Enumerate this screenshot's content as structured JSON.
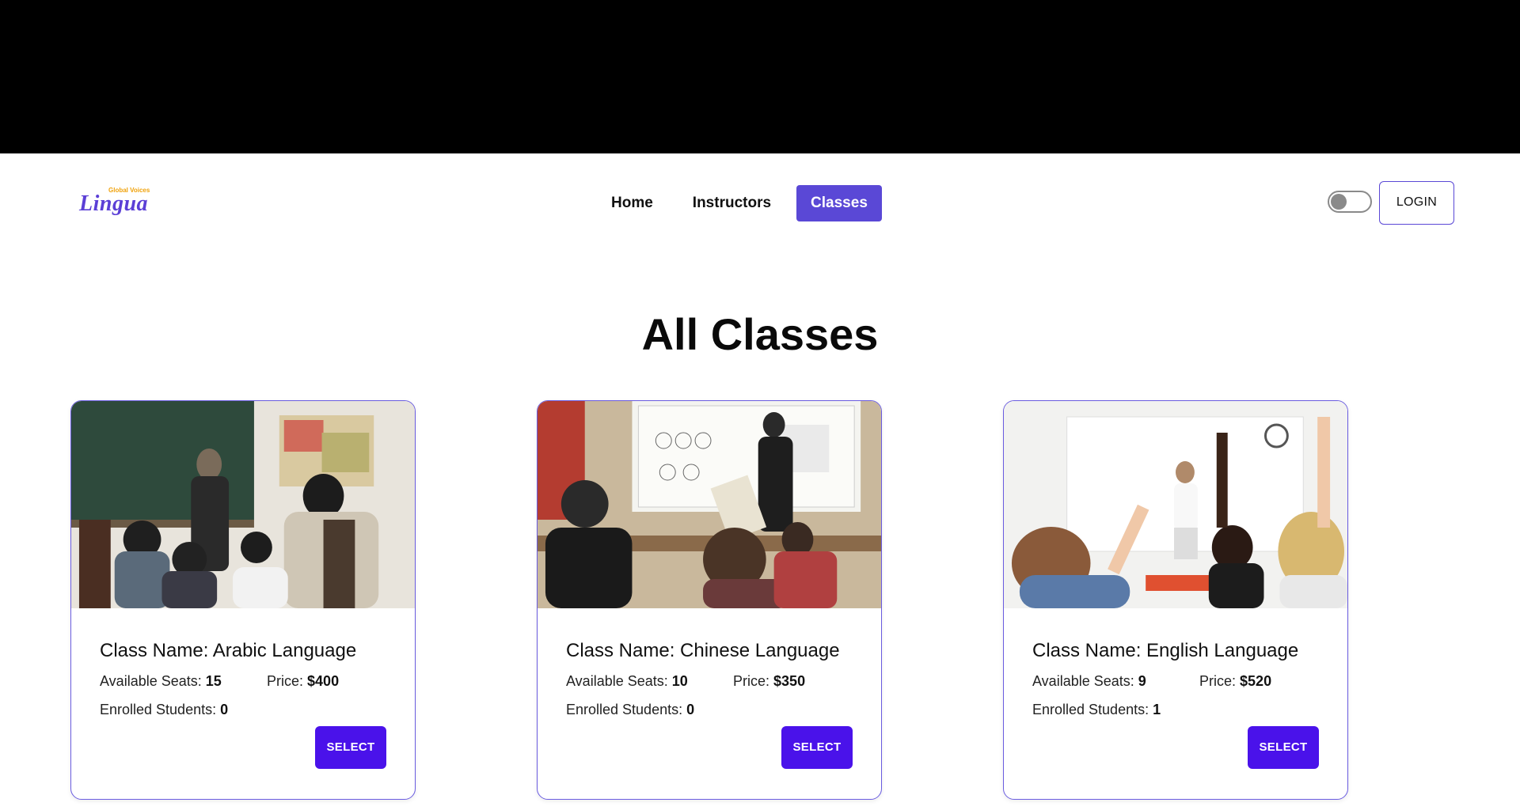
{
  "brand": {
    "tagline": "Global Voices",
    "name": "Lingua"
  },
  "nav": {
    "links": [
      {
        "label": "Home",
        "active": false
      },
      {
        "label": "Instructors",
        "active": false
      },
      {
        "label": "Classes",
        "active": true
      }
    ],
    "theme_toggle": "off",
    "login_label": "LOGIN"
  },
  "page": {
    "title": "All Classes"
  },
  "labels": {
    "class_name": "Class Name:",
    "available_seats": "Available Seats:",
    "price": "Price:",
    "enrolled_students": "Enrolled Students:",
    "select": "SELECT"
  },
  "classes": [
    {
      "name": "Arabic Language",
      "available_seats": "15",
      "price": "$400",
      "enrolled_students": "0",
      "image": "teacher-in-hijab-with-students-classroom-photo"
    },
    {
      "name": "Chinese Language",
      "available_seats": "10",
      "price": "$350",
      "enrolled_students": "0",
      "image": "teacher-at-whiteboard-chinese-characters-photo"
    },
    {
      "name": "English Language",
      "available_seats": "9",
      "price": "$520",
      "enrolled_students": "1",
      "image": "students-raising-hands-classroom-photo"
    }
  ],
  "colors": {
    "accent": "#5a48d6",
    "select_button": "#4a12ea",
    "card_border": "#6a5ce0",
    "logo": "#5b3fd6",
    "logo_tagline": "#f0a20b"
  }
}
